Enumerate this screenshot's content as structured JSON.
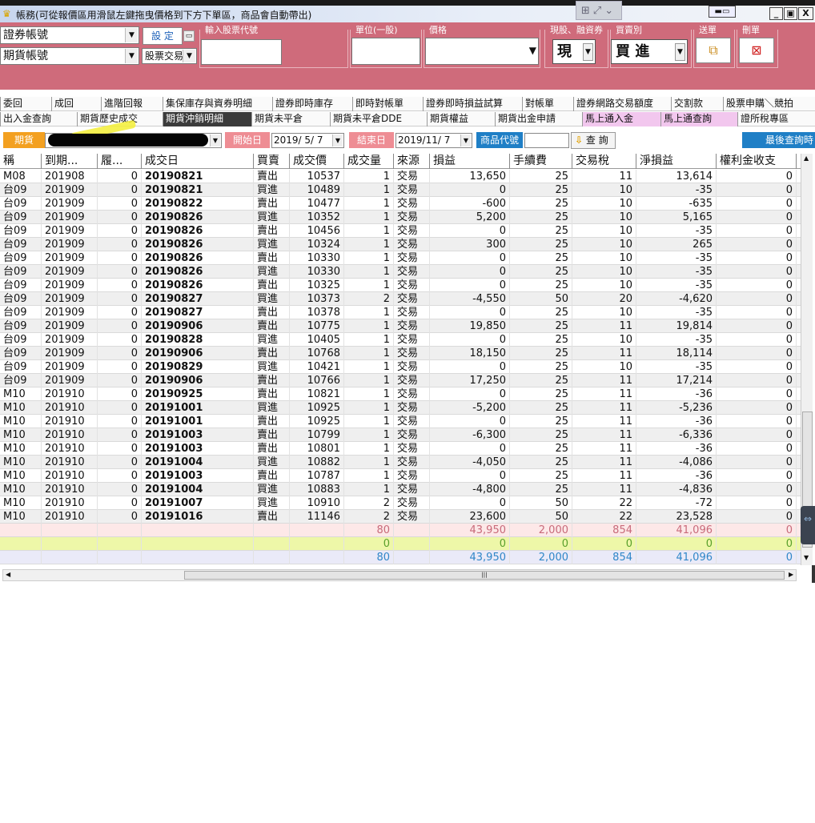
{
  "titlebar": {
    "text": "帳務(可從報價區用滑鼠左鍵拖曳價格到下方下單區，商品會自動帶出)",
    "pin": "▬▭",
    "min": "_",
    "restore": "▣",
    "close": "X"
  },
  "order_panel": {
    "account1": "證券帳號",
    "account2": "期貨帳號",
    "set_btn": "設 定",
    "trade_type": "股票交易",
    "stock_code_label": "輸入股票代號",
    "unit_label": "單位(一股)",
    "price_label": "價格",
    "cash_margin_label": "現股、融資券",
    "cash_margin_value": "現",
    "buy_sell_label": "買賣別",
    "buy_sell_value": "買 進",
    "send_label": "送單",
    "delete_label": "刪單"
  },
  "tabs_row1": [
    "委回",
    "成回",
    "進階回報",
    "集保庫存與資券明細",
    "證券即時庫存",
    "即時對帳單",
    "證券即時損益試算",
    "對帳單",
    "證券網路交易額度",
    "交割款",
    "股票申購＼競拍"
  ],
  "tabs_row2": [
    "出入金查詢",
    "期貨歷史成交",
    "期貨沖銷明細",
    "期貨未平倉",
    "期貨未平倉DDE",
    "期貨權益",
    "期貨出金申請",
    "馬上通入金",
    "馬上通查詢",
    "證所稅專區"
  ],
  "filter": {
    "futures_label": "期貨",
    "start_label": "開始日",
    "start_date": "2019/ 5/ 7",
    "end_label": "結束日",
    "end_date": "2019/11/ 7",
    "product_label": "商品代號",
    "query_btn": "查 詢",
    "last_query": "最後查詢時"
  },
  "columns": [
    "稱",
    "到期...",
    "履...",
    "成交日",
    "買賣",
    "成交價",
    "成交量",
    "來源",
    "損益",
    "手續費",
    "交易稅",
    "淨損益",
    "權利金收支"
  ],
  "rows": [
    [
      "M08",
      "201908",
      "0",
      "20190821",
      "賣出",
      "10537",
      "1",
      "交易",
      "13,650",
      "25",
      "11",
      "13,614",
      "0"
    ],
    [
      "台09",
      "201909",
      "0",
      "20190821",
      "買進",
      "10489",
      "1",
      "交易",
      "0",
      "25",
      "10",
      "-35",
      "0"
    ],
    [
      "台09",
      "201909",
      "0",
      "20190822",
      "賣出",
      "10477",
      "1",
      "交易",
      "-600",
      "25",
      "10",
      "-635",
      "0"
    ],
    [
      "台09",
      "201909",
      "0",
      "20190826",
      "買進",
      "10352",
      "1",
      "交易",
      "5,200",
      "25",
      "10",
      "5,165",
      "0"
    ],
    [
      "台09",
      "201909",
      "0",
      "20190826",
      "賣出",
      "10456",
      "1",
      "交易",
      "0",
      "25",
      "10",
      "-35",
      "0"
    ],
    [
      "台09",
      "201909",
      "0",
      "20190826",
      "買進",
      "10324",
      "1",
      "交易",
      "300",
      "25",
      "10",
      "265",
      "0"
    ],
    [
      "台09",
      "201909",
      "0",
      "20190826",
      "賣出",
      "10330",
      "1",
      "交易",
      "0",
      "25",
      "10",
      "-35",
      "0"
    ],
    [
      "台09",
      "201909",
      "0",
      "20190826",
      "買進",
      "10330",
      "1",
      "交易",
      "0",
      "25",
      "10",
      "-35",
      "0"
    ],
    [
      "台09",
      "201909",
      "0",
      "20190826",
      "賣出",
      "10325",
      "1",
      "交易",
      "0",
      "25",
      "10",
      "-35",
      "0"
    ],
    [
      "台09",
      "201909",
      "0",
      "20190827",
      "買進",
      "10373",
      "2",
      "交易",
      "-4,550",
      "50",
      "20",
      "-4,620",
      "0"
    ],
    [
      "台09",
      "201909",
      "0",
      "20190827",
      "賣出",
      "10378",
      "1",
      "交易",
      "0",
      "25",
      "10",
      "-35",
      "0"
    ],
    [
      "台09",
      "201909",
      "0",
      "20190906",
      "賣出",
      "10775",
      "1",
      "交易",
      "19,850",
      "25",
      "11",
      "19,814",
      "0"
    ],
    [
      "台09",
      "201909",
      "0",
      "20190828",
      "買進",
      "10405",
      "1",
      "交易",
      "0",
      "25",
      "10",
      "-35",
      "0"
    ],
    [
      "台09",
      "201909",
      "0",
      "20190906",
      "賣出",
      "10768",
      "1",
      "交易",
      "18,150",
      "25",
      "11",
      "18,114",
      "0"
    ],
    [
      "台09",
      "201909",
      "0",
      "20190829",
      "買進",
      "10421",
      "1",
      "交易",
      "0",
      "25",
      "10",
      "-35",
      "0"
    ],
    [
      "台09",
      "201909",
      "0",
      "20190906",
      "賣出",
      "10766",
      "1",
      "交易",
      "17,250",
      "25",
      "11",
      "17,214",
      "0"
    ],
    [
      "M10",
      "201910",
      "0",
      "20190925",
      "賣出",
      "10821",
      "1",
      "交易",
      "0",
      "25",
      "11",
      "-36",
      "0"
    ],
    [
      "M10",
      "201910",
      "0",
      "20191001",
      "買進",
      "10925",
      "1",
      "交易",
      "-5,200",
      "25",
      "11",
      "-5,236",
      "0"
    ],
    [
      "M10",
      "201910",
      "0",
      "20191001",
      "賣出",
      "10925",
      "1",
      "交易",
      "0",
      "25",
      "11",
      "-36",
      "0"
    ],
    [
      "M10",
      "201910",
      "0",
      "20191003",
      "賣出",
      "10799",
      "1",
      "交易",
      "-6,300",
      "25",
      "11",
      "-6,336",
      "0"
    ],
    [
      "M10",
      "201910",
      "0",
      "20191003",
      "賣出",
      "10801",
      "1",
      "交易",
      "0",
      "25",
      "11",
      "-36",
      "0"
    ],
    [
      "M10",
      "201910",
      "0",
      "20191004",
      "買進",
      "10882",
      "1",
      "交易",
      "-4,050",
      "25",
      "11",
      "-4,086",
      "0"
    ],
    [
      "M10",
      "201910",
      "0",
      "20191003",
      "賣出",
      "10787",
      "1",
      "交易",
      "0",
      "25",
      "11",
      "-36",
      "0"
    ],
    [
      "M10",
      "201910",
      "0",
      "20191004",
      "買進",
      "10883",
      "1",
      "交易",
      "-4,800",
      "25",
      "11",
      "-4,836",
      "0"
    ],
    [
      "M10",
      "201910",
      "0",
      "20191007",
      "買進",
      "10910",
      "2",
      "交易",
      "0",
      "50",
      "22",
      "-72",
      "0"
    ],
    [
      "M10",
      "201910",
      "0",
      "20191016",
      "賣出",
      "11146",
      "2",
      "交易",
      "23,600",
      "50",
      "22",
      "23,528",
      "0"
    ]
  ],
  "summary": [
    {
      "qty": "80",
      "pnl": "43,950",
      "fee": "2,000",
      "tax": "854",
      "net": "41,096",
      "prem": "0",
      "bg": "#fde8e8",
      "color": "#c86a7a"
    },
    {
      "qty": "0",
      "pnl": "0",
      "fee": "0",
      "tax": "0",
      "net": "0",
      "prem": "0",
      "bg": "#eef7a8",
      "color": "#5aa02c"
    },
    {
      "qty": "80",
      "pnl": "43,950",
      "fee": "2,000",
      "tax": "854",
      "net": "41,096",
      "prem": "0",
      "bg": "#eaeaf8",
      "color": "#2f86c8"
    }
  ],
  "colors": {
    "panel": "#cf6b7b",
    "chip_orange": "#f3a020",
    "chip_pink": "#ee8d94",
    "chip_blue": "#1f7fc6",
    "tab_active": "#3b3b3b",
    "tab_pink": "#f2c7ee"
  },
  "icons": {
    "app": "crown-icon",
    "send": "send-order-icon",
    "delete": "delete-order-icon",
    "query": "arrow-down-icon"
  }
}
